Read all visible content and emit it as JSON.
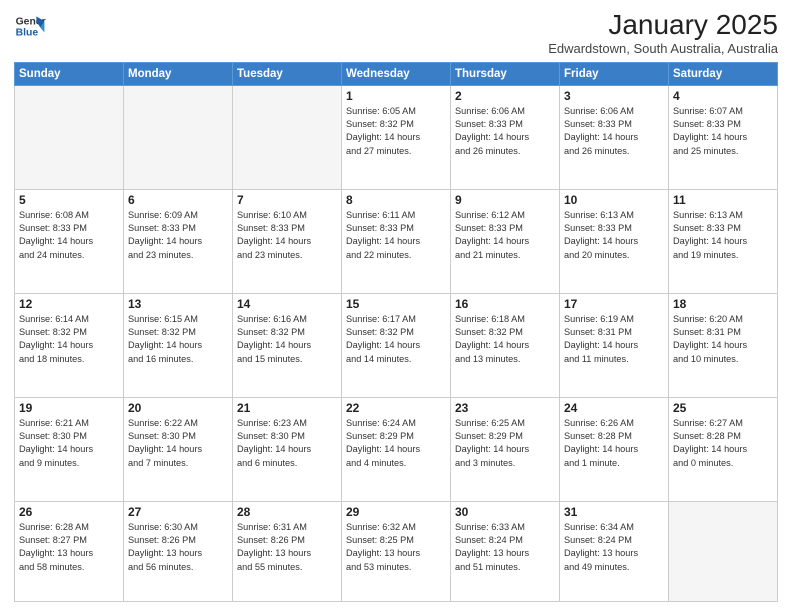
{
  "logo": {
    "line1": "General",
    "line2": "Blue"
  },
  "title": "January 2025",
  "subtitle": "Edwardstown, South Australia, Australia",
  "header_days": [
    "Sunday",
    "Monday",
    "Tuesday",
    "Wednesday",
    "Thursday",
    "Friday",
    "Saturday"
  ],
  "weeks": [
    [
      {
        "day": "",
        "info": ""
      },
      {
        "day": "",
        "info": ""
      },
      {
        "day": "",
        "info": ""
      },
      {
        "day": "1",
        "info": "Sunrise: 6:05 AM\nSunset: 8:32 PM\nDaylight: 14 hours\nand 27 minutes."
      },
      {
        "day": "2",
        "info": "Sunrise: 6:06 AM\nSunset: 8:33 PM\nDaylight: 14 hours\nand 26 minutes."
      },
      {
        "day": "3",
        "info": "Sunrise: 6:06 AM\nSunset: 8:33 PM\nDaylight: 14 hours\nand 26 minutes."
      },
      {
        "day": "4",
        "info": "Sunrise: 6:07 AM\nSunset: 8:33 PM\nDaylight: 14 hours\nand 25 minutes."
      }
    ],
    [
      {
        "day": "5",
        "info": "Sunrise: 6:08 AM\nSunset: 8:33 PM\nDaylight: 14 hours\nand 24 minutes."
      },
      {
        "day": "6",
        "info": "Sunrise: 6:09 AM\nSunset: 8:33 PM\nDaylight: 14 hours\nand 23 minutes."
      },
      {
        "day": "7",
        "info": "Sunrise: 6:10 AM\nSunset: 8:33 PM\nDaylight: 14 hours\nand 23 minutes."
      },
      {
        "day": "8",
        "info": "Sunrise: 6:11 AM\nSunset: 8:33 PM\nDaylight: 14 hours\nand 22 minutes."
      },
      {
        "day": "9",
        "info": "Sunrise: 6:12 AM\nSunset: 8:33 PM\nDaylight: 14 hours\nand 21 minutes."
      },
      {
        "day": "10",
        "info": "Sunrise: 6:13 AM\nSunset: 8:33 PM\nDaylight: 14 hours\nand 20 minutes."
      },
      {
        "day": "11",
        "info": "Sunrise: 6:13 AM\nSunset: 8:33 PM\nDaylight: 14 hours\nand 19 minutes."
      }
    ],
    [
      {
        "day": "12",
        "info": "Sunrise: 6:14 AM\nSunset: 8:32 PM\nDaylight: 14 hours\nand 18 minutes."
      },
      {
        "day": "13",
        "info": "Sunrise: 6:15 AM\nSunset: 8:32 PM\nDaylight: 14 hours\nand 16 minutes."
      },
      {
        "day": "14",
        "info": "Sunrise: 6:16 AM\nSunset: 8:32 PM\nDaylight: 14 hours\nand 15 minutes."
      },
      {
        "day": "15",
        "info": "Sunrise: 6:17 AM\nSunset: 8:32 PM\nDaylight: 14 hours\nand 14 minutes."
      },
      {
        "day": "16",
        "info": "Sunrise: 6:18 AM\nSunset: 8:32 PM\nDaylight: 14 hours\nand 13 minutes."
      },
      {
        "day": "17",
        "info": "Sunrise: 6:19 AM\nSunset: 8:31 PM\nDaylight: 14 hours\nand 11 minutes."
      },
      {
        "day": "18",
        "info": "Sunrise: 6:20 AM\nSunset: 8:31 PM\nDaylight: 14 hours\nand 10 minutes."
      }
    ],
    [
      {
        "day": "19",
        "info": "Sunrise: 6:21 AM\nSunset: 8:30 PM\nDaylight: 14 hours\nand 9 minutes."
      },
      {
        "day": "20",
        "info": "Sunrise: 6:22 AM\nSunset: 8:30 PM\nDaylight: 14 hours\nand 7 minutes."
      },
      {
        "day": "21",
        "info": "Sunrise: 6:23 AM\nSunset: 8:30 PM\nDaylight: 14 hours\nand 6 minutes."
      },
      {
        "day": "22",
        "info": "Sunrise: 6:24 AM\nSunset: 8:29 PM\nDaylight: 14 hours\nand 4 minutes."
      },
      {
        "day": "23",
        "info": "Sunrise: 6:25 AM\nSunset: 8:29 PM\nDaylight: 14 hours\nand 3 minutes."
      },
      {
        "day": "24",
        "info": "Sunrise: 6:26 AM\nSunset: 8:28 PM\nDaylight: 14 hours\nand 1 minute."
      },
      {
        "day": "25",
        "info": "Sunrise: 6:27 AM\nSunset: 8:28 PM\nDaylight: 14 hours\nand 0 minutes."
      }
    ],
    [
      {
        "day": "26",
        "info": "Sunrise: 6:28 AM\nSunset: 8:27 PM\nDaylight: 13 hours\nand 58 minutes."
      },
      {
        "day": "27",
        "info": "Sunrise: 6:30 AM\nSunset: 8:26 PM\nDaylight: 13 hours\nand 56 minutes."
      },
      {
        "day": "28",
        "info": "Sunrise: 6:31 AM\nSunset: 8:26 PM\nDaylight: 13 hours\nand 55 minutes."
      },
      {
        "day": "29",
        "info": "Sunrise: 6:32 AM\nSunset: 8:25 PM\nDaylight: 13 hours\nand 53 minutes."
      },
      {
        "day": "30",
        "info": "Sunrise: 6:33 AM\nSunset: 8:24 PM\nDaylight: 13 hours\nand 51 minutes."
      },
      {
        "day": "31",
        "info": "Sunrise: 6:34 AM\nSunset: 8:24 PM\nDaylight: 13 hours\nand 49 minutes."
      },
      {
        "day": "",
        "info": ""
      }
    ]
  ]
}
